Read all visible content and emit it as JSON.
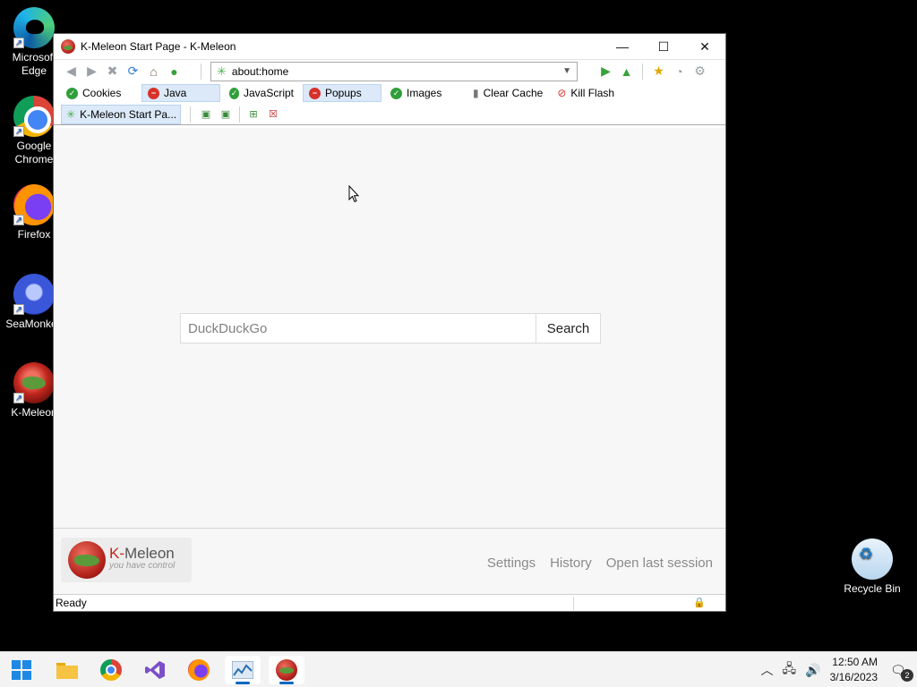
{
  "desktop": {
    "icons": [
      {
        "label": "Microsoft Edge"
      },
      {
        "label": "Google Chrome"
      },
      {
        "label": "Firefox"
      },
      {
        "label": "SeaMonkey"
      },
      {
        "label": "K-Meleon"
      }
    ],
    "recycle_bin": {
      "label": "Recycle Bin"
    }
  },
  "window": {
    "title": "K-Meleon Start Page - K-Meleon",
    "controls": {
      "minimize": "—",
      "maximize": "☐",
      "close": "✕"
    }
  },
  "navbar": {
    "url": "about:home"
  },
  "privacy_bar": {
    "items": [
      {
        "label": "Cookies",
        "state": "allowed"
      },
      {
        "label": "Java",
        "state": "blocked"
      },
      {
        "label": "JavaScript",
        "state": "allowed"
      },
      {
        "label": "Popups",
        "state": "blocked"
      },
      {
        "label": "Images",
        "state": "allowed"
      },
      {
        "label": "Clear Cache"
      },
      {
        "label": "Kill Flash"
      }
    ]
  },
  "tabs": [
    {
      "label": "K-Meleon Start Pa..."
    }
  ],
  "page": {
    "search": {
      "placeholder": "DuckDuckGo",
      "button": "Search"
    },
    "logo": {
      "name_k": "K-",
      "name_rest": "Meleon",
      "tagline": "you have control"
    },
    "footer_links": [
      "Settings",
      "History",
      "Open last session"
    ]
  },
  "status": {
    "text": "Ready"
  },
  "taskbar": {
    "time": "12:50 AM",
    "date": "3/16/2023",
    "notifications": "2"
  },
  "colors": {
    "accent": "#0067c0",
    "tab_active": "#dbe9f9",
    "allowed": "#2f9e3b",
    "blocked": "#d6322b"
  }
}
